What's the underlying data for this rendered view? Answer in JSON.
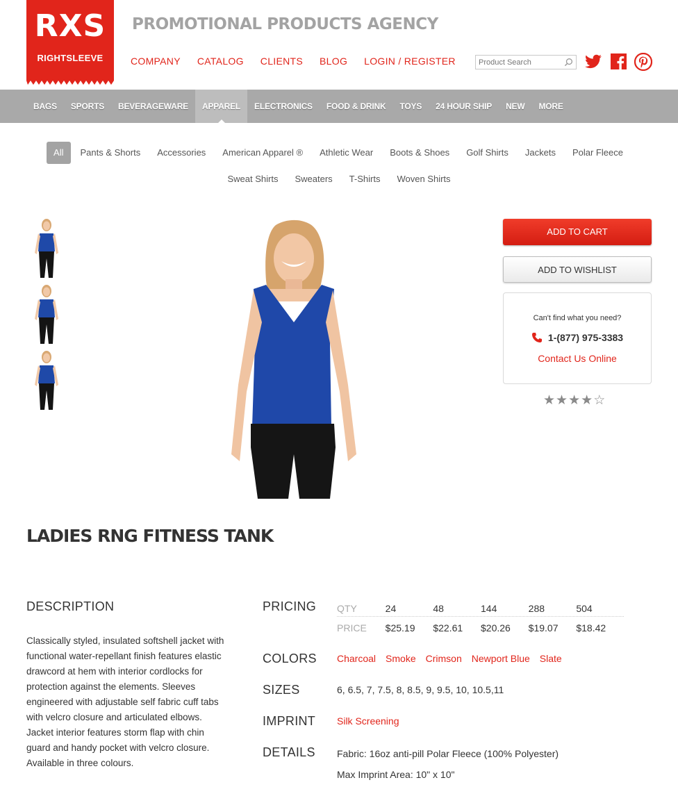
{
  "brand": {
    "mark": "RXS",
    "wordmark": "RIGHTSLEEVE",
    "tagline": "PROMOTIONAL PRODUCTS AGENCY",
    "accent": "#e1251b"
  },
  "topnav": [
    "COMPANY",
    "CATALOG",
    "CLIENTS",
    "BLOG",
    "LOGIN / REGISTER"
  ],
  "search": {
    "placeholder": "Product Search"
  },
  "social": [
    "twitter-icon",
    "facebook-icon",
    "pinterest-icon"
  ],
  "categories": [
    "BAGS",
    "SPORTS",
    "BEVERAGEWARE",
    "APPAREL",
    "ELECTRONICS",
    "FOOD & DRINK",
    "TOYS",
    "24 HOUR SHIP",
    "NEW",
    "MORE"
  ],
  "active_category": "APPAREL",
  "subcategories": {
    "row1": [
      "All",
      "Pants & Shorts",
      "Accessories",
      "American Apparel ®",
      "Athletic Wear",
      "Boots & Shoes",
      "Golf Shirts",
      "Jackets",
      "Polar Fleece"
    ],
    "row2": [
      "Sweat Shirts",
      "Sweaters",
      "T-Shirts",
      "Woven Shirts"
    ],
    "active": "All"
  },
  "actions": {
    "cart": "ADD TO CART",
    "wishlist": "ADD TO WISHLIST"
  },
  "help": {
    "question": "Can't find what you need?",
    "phone": "1-(877) 975-3383",
    "contact": "Contact Us Online"
  },
  "rating": {
    "value": 4,
    "max": 5
  },
  "product": {
    "title": "LADIES RNG FITNESS TANK",
    "description_heading": "DESCRIPTION",
    "description": "Classically styled, insulated softshell jacket with functional water-repellant finish features elastic drawcord at hem with interior cordlocks for protection against the elements. Sleeves engineered with adjustable self fabric cuff tabs with velcro closure and articulated elbows. Jacket interior features storm flap with chin guard and handy pocket with velcro closure. Available in three colours."
  },
  "specs": {
    "pricing_label": "PRICING",
    "qty_label": "QTY",
    "price_label": "PRICE",
    "quantities": [
      "24",
      "48",
      "144",
      "288",
      "504"
    ],
    "prices": [
      "$25.19",
      "$22.61",
      "$20.26",
      "$19.07",
      "$18.42"
    ],
    "colors_label": "COLORS",
    "colors": [
      "Charcoal",
      "Smoke",
      "Crimson",
      "Newport Blue",
      "Slate"
    ],
    "sizes_label": "SIZES",
    "sizes": "6, 6.5, 7, 7.5, 8, 8.5, 9, 9.5, 10, 10.5,11",
    "imprint_label": "IMPRINT",
    "imprint": "Silk Screening",
    "details_label": "DETAILS",
    "details": [
      "Fabric: 16oz anti-pill Polar Fleece (100% Polyester)",
      "Max Imprint Area: 10\" x 10\""
    ]
  }
}
